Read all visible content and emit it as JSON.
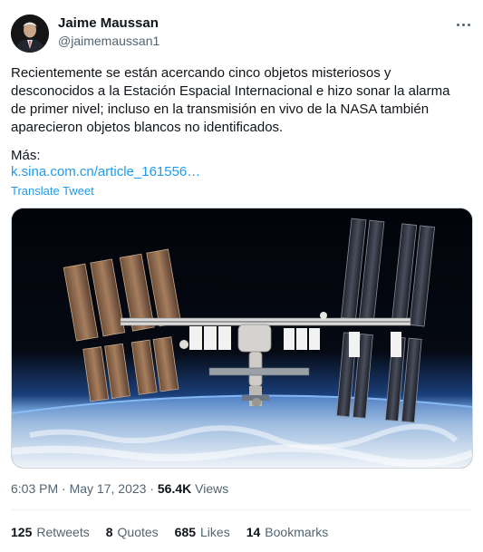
{
  "author": {
    "name": "Jaime Maussan",
    "handle": "@jaimemaussan1"
  },
  "tweet": {
    "text": "Recientemente se están acercando cinco objetos misteriosos y\ndesconocidos a la Estación Espacial Internacional e hizo sonar la alarma\nde primer nivel; incluso en la transmisión en vivo de la NASA también\naparecieron objetos blancos no identificados.",
    "more_label": "Más:",
    "link_text": "k.sina.com.cn/article_161556…",
    "translate_label": "Translate Tweet",
    "media": {
      "description_icon": "space-station-image"
    }
  },
  "meta": {
    "time": "6:03 PM",
    "separator": "·",
    "date": "May 17, 2023",
    "views_count": "56.4K",
    "views_label": "Views"
  },
  "stats": {
    "retweets_count": "125",
    "retweets_label": "Retweets",
    "quotes_count": "8",
    "quotes_label": "Quotes",
    "likes_count": "685",
    "likes_label": "Likes",
    "bookmarks_count": "14",
    "bookmarks_label": "Bookmarks"
  },
  "colors": {
    "link": "#1d9bf0",
    "secondary_text": "#536471",
    "primary_text": "#0f1419"
  }
}
